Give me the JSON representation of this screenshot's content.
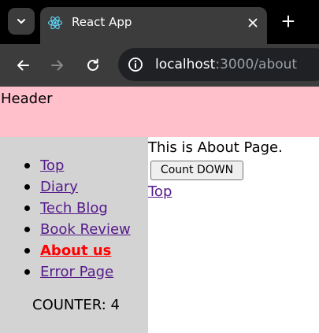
{
  "browser": {
    "tab": {
      "title": "React App",
      "favicon": "react-logo-icon"
    },
    "address": {
      "host": "localhost",
      "path": ":3000/about"
    },
    "icons": {
      "tab_dropdown": "chevron-down-icon",
      "tab_close": "close-icon",
      "new_tab": "plus-icon",
      "back": "arrow-left-icon",
      "forward": "arrow-right-icon",
      "reload": "reload-icon",
      "site_info": "info-icon"
    },
    "colors": {
      "tabbar": "#000000",
      "toolbar": "#3c3c3c",
      "omnibox": "#202124",
      "react_logo": "#61dafb"
    }
  },
  "app": {
    "header": {
      "title": "Header",
      "background": "#ffc0cb"
    },
    "sidebar": {
      "background": "#d3d3d3",
      "items": [
        {
          "label": "Top",
          "active": false
        },
        {
          "label": "Diary",
          "active": false
        },
        {
          "label": "Tech Blog",
          "active": false
        },
        {
          "label": "Book Review",
          "active": false
        },
        {
          "label": "About us",
          "active": true
        },
        {
          "label": "Error Page",
          "active": false
        }
      ],
      "counter_label": "COUNTER: 4",
      "active_color": "#ff0000"
    },
    "main": {
      "text": "This is About Page.",
      "button_label": "Count DOWN",
      "link_label": "Top"
    }
  }
}
